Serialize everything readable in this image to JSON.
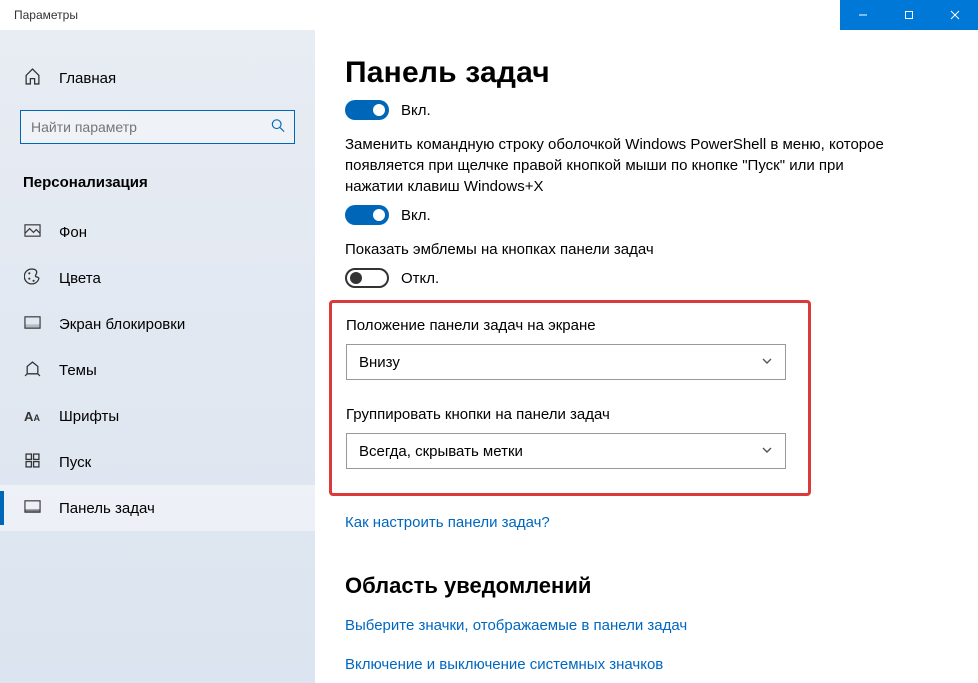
{
  "window": {
    "title": "Параметры"
  },
  "sidebar": {
    "home": "Главная",
    "search_placeholder": "Найти параметр",
    "category": "Персонализация",
    "items": [
      {
        "label": "Фон"
      },
      {
        "label": "Цвета"
      },
      {
        "label": "Экран блокировки"
      },
      {
        "label": "Темы"
      },
      {
        "label": "Шрифты"
      },
      {
        "label": "Пуск"
      },
      {
        "label": "Панель задач"
      }
    ]
  },
  "main": {
    "title": "Панель задач",
    "toggle1": {
      "state": "Вкл."
    },
    "powershell_desc": "Заменить командную строку оболочкой Windows PowerShell в меню, которое появляется при щелчке правой кнопкой мыши по кнопке \"Пуск\" или при нажатии клавиш Windows+X",
    "toggle2": {
      "state": "Вкл."
    },
    "badges_label": "Показать эмблемы на кнопках панели задач",
    "toggle3": {
      "state": "Откл."
    },
    "position_label": "Положение панели задач на экране",
    "position_value": "Внизу",
    "group_label": "Группировать кнопки на панели задач",
    "group_value": "Всегда, скрывать метки",
    "help_link": "Как настроить панели задач?",
    "notif_heading": "Область уведомлений",
    "notif_link1": "Выберите значки, отображаемые в панели задач",
    "notif_link2": "Включение и выключение системных значков"
  }
}
